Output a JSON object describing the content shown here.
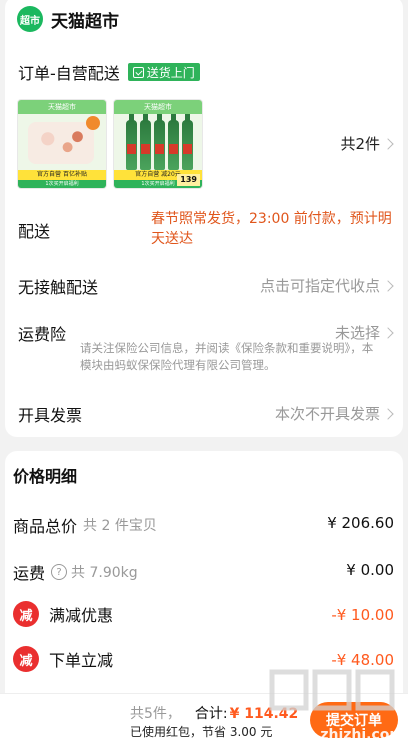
{
  "store": {
    "logo_text": "超市",
    "name": "天猫超市"
  },
  "order": {
    "title": "订单-自营配送",
    "delivery_tag": "送货上门",
    "items_count_label": "共2件",
    "thumbnails": [
      {
        "brand": "天猫超市",
        "band": "官方自营  百亿补贴",
        "bottom": "1次买开启福利"
      },
      {
        "brand": "天猫超市",
        "band": "官方自营 减20元",
        "bottom": "1次买开启福利",
        "price": "139"
      }
    ]
  },
  "rows": {
    "shipping": {
      "label": "配送",
      "note": "春节照常发货，23:00 前付款，预计明天送达"
    },
    "contactless": {
      "label": "无接触配送",
      "value": "点击可指定代收点"
    },
    "insurance": {
      "label": "运费险",
      "value": "未选择",
      "note": "请关注保险公司信息，并阅读《保险条款和重要说明》，本模块由蚂蚁保保险代理有限公司管理。"
    },
    "invoice": {
      "label": "开具发票",
      "value": "本次不开具发票"
    }
  },
  "price_detail": {
    "title": "价格明细",
    "goods_total": {
      "label": "商品总价",
      "note": "共 2 件宝贝",
      "amount": "¥ 206.60"
    },
    "freight": {
      "label": "运费",
      "note": "共 7.90kg",
      "amount": "¥ 0.00"
    },
    "full_discount": {
      "label": "满减优惠",
      "amount": "-¥ 10.00",
      "icon_text": "减"
    },
    "instant_discount": {
      "label": "下单立减",
      "amount": "-¥ 48.00",
      "icon_text": "减"
    }
  },
  "summary": {
    "count": "共5件，",
    "total_label": "合计:",
    "total": "¥ 114.42",
    "saved": "已使用红包，节省 3.00 元",
    "submit_label": "提交订单"
  },
  "watermark": {
    "text": "zhizhi.com"
  },
  "colors": {
    "brand_green": "#1bb85f",
    "accent_orange": "#ff5a1f",
    "discount_red": "#ea2f2f"
  }
}
